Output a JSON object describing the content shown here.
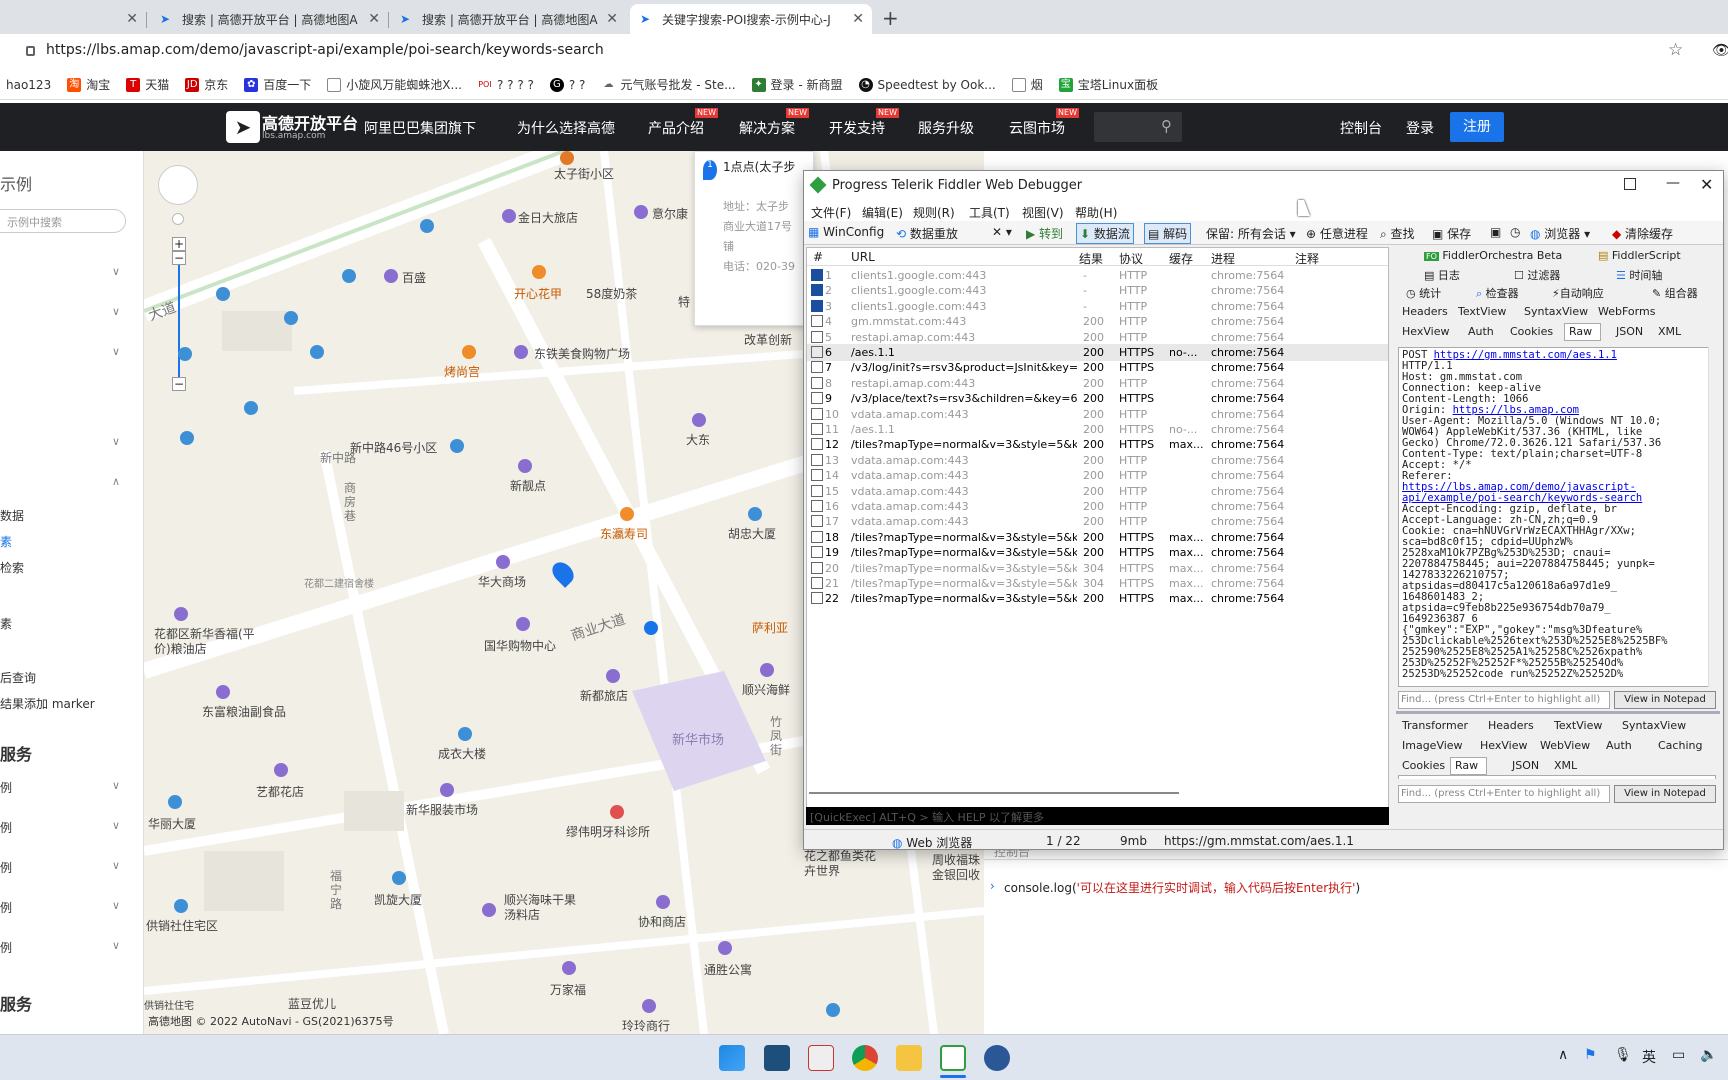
{
  "browser": {
    "tabs": [
      {
        "label": "",
        "close": "✕"
      },
      {
        "label": "搜索 | 高德开放平台 | 高德地图A",
        "close": "✕"
      },
      {
        "label": "搜索 | 高德开放平台 | 高德地图A",
        "close": "✕"
      },
      {
        "label": "关键字搜索-POI搜索-示例中心-J",
        "close": "✕"
      }
    ],
    "new_tab": "+",
    "url": "https://lbs.amap.com/demo/javascript-api/example/poi-search/keywords-search",
    "bookmarks": [
      "hao123",
      "淘宝",
      "天猫",
      "京东",
      "百度一下",
      "小旋风万能蜘蛛池X...",
      "? ? ? ?",
      "? ?",
      "元气账号批发 - Ste...",
      "登录 - 新商盟",
      "Speedtest by Ook...",
      "烟",
      "宝塔Linux面板"
    ]
  },
  "amap_nav": {
    "logo": "高德开放平台",
    "logo_sub": "lbs.amap.com",
    "items": [
      {
        "label": "阿里巴巴集团旗下",
        "tag": ""
      },
      {
        "label": "为什么选择高德",
        "tag": ""
      },
      {
        "label": "产品介绍",
        "tag": "NEW"
      },
      {
        "label": "解决方案",
        "tag": "NEW"
      },
      {
        "label": "开发支持",
        "tag": "NEW"
      },
      {
        "label": "服务升级",
        "tag": ""
      },
      {
        "label": "云图市场",
        "tag": "NEW"
      }
    ],
    "console": "控制台",
    "login": "登录",
    "register": "注册"
  },
  "sidebar": {
    "title": "示例",
    "search_placeholder": "示例中搜索",
    "items": [
      "数据",
      "素",
      "检索",
      "素",
      "后查询",
      "结果添加 marker",
      "服务",
      "例",
      "例",
      "例",
      "例",
      "例",
      "服务"
    ]
  },
  "map": {
    "info_title": "1点点(太子步",
    "info_addr": "地址：太子步",
    "info_addr2": "商业大道17号",
    "info_extra": "铺",
    "info_tel": "电话：020-39",
    "pois": [
      "太子街小区",
      "金日大旅店",
      "意尔康",
      "百盛",
      "开心花甲",
      "58度奶茶",
      "特",
      "烤尚宫",
      "东铁美食购物广场",
      "改革创新",
      "新中路46号小区",
      "大东",
      "新靓点",
      "东瀛寿司",
      "胡忠大厦",
      "华大商场",
      "花都二建宿舍楼",
      "萨利亚",
      "花都区新华香福(平价)粮油店",
      "国华购物中心",
      "商业大道",
      "新都旅店",
      "顺兴海鲜",
      "东富粮油副食品",
      "新华市场",
      "成衣大楼",
      "艺都花店",
      "新华服装市场",
      "缪伟明牙科诊所",
      "华丽大厦",
      "花之都鱼类花卉世界",
      "周收福珠金银回收",
      "凯旋大厦",
      "顺兴海味干果汤料店",
      "协和商店",
      "供销社住宅区",
      "通胜公寓",
      "万家福",
      "蓝豆优儿",
      "玲玲商行",
      "供销社住宅",
      "新中路",
      "商房巷",
      "福宁路",
      "竹凤街",
      "大道"
    ],
    "copyright": "高德地图 © 2022 AutoNavi - GS(2021)6375号"
  },
  "right_panel": {
    "console_label": "控制台",
    "console_cmd": "console.log(",
    "console_msg": "'可以在这里进行实时调试，输入代码后按Enter执行'",
    "console_close": ")"
  },
  "fiddler": {
    "title": "Progress Telerik Fiddler Web Debugger",
    "menu": [
      "文件(F)",
      "编辑(E)",
      "规则(R)",
      "工具(T)",
      "视图(V)",
      "帮助(H)"
    ],
    "toolbar": [
      "WinConfig",
      "数据重放",
      "✕ ▾",
      "▶ 转到",
      "数据流",
      "解码",
      "保留: 所有会话 ▾",
      "任意进程",
      "查找",
      "保存",
      "浏览器 ▾",
      "清除缓存"
    ],
    "columns": [
      "#",
      "URL",
      "结果",
      "协议",
      "缓存",
      "进程",
      "注释"
    ],
    "sessions": [
      {
        "n": "1",
        "url": "clients1.google.com:443",
        "res": "-",
        "proto": "HTTP",
        "cache": "",
        "proc": "chrome:7564",
        "dim": true
      },
      {
        "n": "2",
        "url": "clients1.google.com:443",
        "res": "-",
        "proto": "HTTP",
        "cache": "",
        "proc": "chrome:7564",
        "dim": true
      },
      {
        "n": "3",
        "url": "clients1.google.com:443",
        "res": "-",
        "proto": "HTTP",
        "cache": "",
        "proc": "chrome:7564",
        "dim": true
      },
      {
        "n": "4",
        "url": "gm.mmstat.com:443",
        "res": "200",
        "proto": "HTTP",
        "cache": "",
        "proc": "chrome:7564",
        "dim": true
      },
      {
        "n": "5",
        "url": "restapi.amap.com:443",
        "res": "200",
        "proto": "HTTP",
        "cache": "",
        "proc": "chrome:7564",
        "dim": true
      },
      {
        "n": "6",
        "url": "/aes.1.1",
        "res": "200",
        "proto": "HTTPS",
        "cache": "no-...",
        "proc": "chrome:7564",
        "dim": false
      },
      {
        "n": "7",
        "url": "/v3/log/init?s=rsv3&product=JsInit&key=6e7...",
        "res": "200",
        "proto": "HTTPS",
        "cache": "",
        "proc": "chrome:7564",
        "dim": false
      },
      {
        "n": "8",
        "url": "restapi.amap.com:443",
        "res": "200",
        "proto": "HTTP",
        "cache": "",
        "proc": "chrome:7564",
        "dim": true
      },
      {
        "n": "9",
        "url": "/v3/place/text?s=rsv3&children=&key=6e79...",
        "res": "200",
        "proto": "HTTPS",
        "cache": "",
        "proc": "chrome:7564",
        "dim": false
      },
      {
        "n": "10",
        "url": "vdata.amap.com:443",
        "res": "200",
        "proto": "HTTP",
        "cache": "",
        "proc": "chrome:7564",
        "dim": true
      },
      {
        "n": "11",
        "url": "/aes.1.1",
        "res": "200",
        "proto": "HTTPS",
        "cache": "no-...",
        "proc": "chrome:7564",
        "dim": true
      },
      {
        "n": "12",
        "url": "/tiles?mapType=normal&v=3&style=5&key=...",
        "res": "200",
        "proto": "HTTPS",
        "cache": "max...",
        "proc": "chrome:7564",
        "dim": false
      },
      {
        "n": "13",
        "url": "vdata.amap.com:443",
        "res": "200",
        "proto": "HTTP",
        "cache": "",
        "proc": "chrome:7564",
        "dim": true
      },
      {
        "n": "14",
        "url": "vdata.amap.com:443",
        "res": "200",
        "proto": "HTTP",
        "cache": "",
        "proc": "chrome:7564",
        "dim": true
      },
      {
        "n": "15",
        "url": "vdata.amap.com:443",
        "res": "200",
        "proto": "HTTP",
        "cache": "",
        "proc": "chrome:7564",
        "dim": true
      },
      {
        "n": "16",
        "url": "vdata.amap.com:443",
        "res": "200",
        "proto": "HTTP",
        "cache": "",
        "proc": "chrome:7564",
        "dim": true
      },
      {
        "n": "17",
        "url": "vdata.amap.com:443",
        "res": "200",
        "proto": "HTTP",
        "cache": "",
        "proc": "chrome:7564",
        "dim": true
      },
      {
        "n": "18",
        "url": "/tiles?mapType=normal&v=3&style=5&key=...",
        "res": "200",
        "proto": "HTTPS",
        "cache": "max...",
        "proc": "chrome:7564",
        "dim": false
      },
      {
        "n": "19",
        "url": "/tiles?mapType=normal&v=3&style=5&key=...",
        "res": "200",
        "proto": "HTTPS",
        "cache": "max...",
        "proc": "chrome:7564",
        "dim": false
      },
      {
        "n": "20",
        "url": "/tiles?mapType=normal&v=3&style=5&key=...",
        "res": "304",
        "proto": "HTTPS",
        "cache": "max...",
        "proc": "chrome:7564",
        "dim": true
      },
      {
        "n": "21",
        "url": "/tiles?mapType=normal&v=3&style=5&key=...",
        "res": "304",
        "proto": "HTTPS",
        "cache": "max...",
        "proc": "chrome:7564",
        "dim": true
      },
      {
        "n": "22",
        "url": "/tiles?mapType=normal&v=3&style=5&key=...",
        "res": "200",
        "proto": "HTTPS",
        "cache": "max...",
        "proc": "chrome:7564",
        "dim": false
      }
    ],
    "inspector_top_tabs": [
      "FiddlerOrchestra Beta",
      "FiddlerScript",
      "日志",
      "过滤器",
      "时间轴",
      "统计",
      "检查器",
      "自动响应",
      "组合器"
    ],
    "req_tabs1": [
      "Headers",
      "TextView",
      "SyntaxView",
      "WebForms"
    ],
    "req_tabs2": [
      "HexView",
      "Auth",
      "Cookies",
      "Raw",
      "JSON",
      "XML"
    ],
    "raw_lines": [
      {
        "t": "POST ",
        "l": "https://gm.mmstat.com/aes.1.1"
      },
      {
        "t": "HTTP/1.1",
        "l": ""
      },
      {
        "t": "Host: gm.mmstat.com",
        "l": ""
      },
      {
        "t": "Connection: keep-alive",
        "l": ""
      },
      {
        "t": "Content-Length: 1066",
        "l": ""
      },
      {
        "t": "Origin: ",
        "l": "https://lbs.amap.com"
      },
      {
        "t": "User-Agent: Mozilla/5.0 (Windows NT 10.0;",
        "l": ""
      },
      {
        "t": "WOW64) AppleWebKit/537.36 (KHTML, like",
        "l": ""
      },
      {
        "t": "Gecko) Chrome/72.0.3626.121 Safari/537.36",
        "l": ""
      },
      {
        "t": "Content-Type: text/plain;charset=UTF-8",
        "l": ""
      },
      {
        "t": "Accept: */*",
        "l": ""
      },
      {
        "t": "Referer:",
        "l": ""
      },
      {
        "t": "",
        "l": "https://lbs.amap.com/demo/javascript-"
      },
      {
        "t": "",
        "l": "api/example/poi-search/keywords-search"
      },
      {
        "t": "Accept-Encoding: gzip, deflate, br",
        "l": ""
      },
      {
        "t": "Accept-Language: zh-CN,zh;q=0.9",
        "l": ""
      },
      {
        "t": "Cookie: cna=hNUVGrVrWzECAXTHHAgr/XXw;",
        "l": ""
      },
      {
        "t": "sca=bd8c0f15; cdpid=UUphzW%",
        "l": ""
      },
      {
        "t": "2528xaM1Ok7PZBg%253D%253D; cnaui=",
        "l": ""
      },
      {
        "t": "2207884758445; aui=2207884758445; yunpk=",
        "l": ""
      },
      {
        "t": "1427833226210757;",
        "l": ""
      },
      {
        "t": "atpsidas=d80417c5a120618a6a97d1e9_",
        "l": ""
      },
      {
        "t": "1648601483_2;",
        "l": ""
      },
      {
        "t": "atpsida=c9feb8b225e936754db70a79_",
        "l": ""
      },
      {
        "t": "1649236387_6",
        "l": ""
      },
      {
        "t": "",
        "l": ""
      },
      {
        "t": "{\"gmkey\":\"EXP\",\"gokey\":\"msg%3Dfeature%",
        "l": ""
      },
      {
        "t": "253Dclickable%2526text%253D%2525E8%2525BF%",
        "l": ""
      },
      {
        "t": "252590%2525E8%2525A1%25258C%2526xpath%",
        "l": ""
      },
      {
        "t": "253D%25252F%25252F*%25255B%25254Od%",
        "l": ""
      },
      {
        "t": "25253D%25252code run%25252Z%25252D%",
        "l": ""
      }
    ],
    "find_placeholder": "Find... (press Ctrl+Enter to highlight all)",
    "view_notepad": "View in Notepad",
    "resp_tabs1": [
      "Transformer",
      "Headers",
      "TextView",
      "SyntaxView"
    ],
    "resp_tabs2": [
      "ImageView",
      "HexView",
      "WebView",
      "Auth",
      "Caching"
    ],
    "resp_tabs3": [
      "Cookies",
      "Raw",
      "JSON",
      "XML"
    ],
    "quickexec": "[QuickExec] ALT+Q > 输入 HELP 以了解更多",
    "status": {
      "browser": "Web 浏览器",
      "count": "1 / 22",
      "mem": "9mb",
      "url": "https://gm.mmstat.com/aes.1.1"
    }
  },
  "taskbar": {
    "ime": "英"
  }
}
